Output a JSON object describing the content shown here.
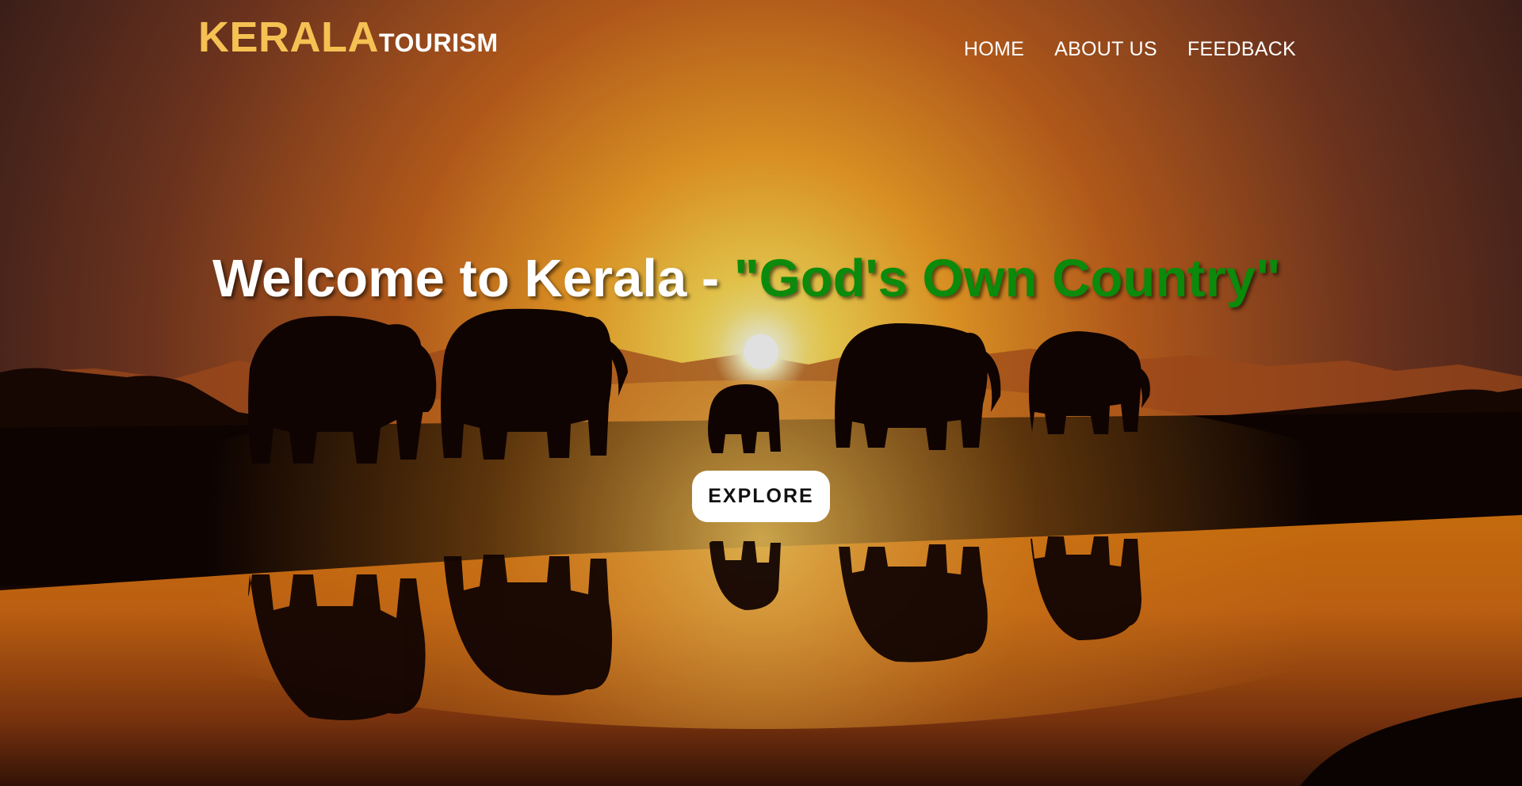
{
  "brand": {
    "name": "KERALA",
    "suffix": "TOURISM",
    "name_color": "#f5c153",
    "suffix_color": "#ffffff"
  },
  "nav": {
    "items": [
      {
        "label": "HOME"
      },
      {
        "label": "ABOUT US"
      },
      {
        "label": "FEEDBACK"
      }
    ]
  },
  "hero": {
    "headline_part1": "Welcome to Kerala - ",
    "headline_part2": "\"God's Own Country\"",
    "headline_part2_color": "#0b8a0b",
    "cta_label": "EXPLORE",
    "background": "sunset-elephants-reflection"
  }
}
